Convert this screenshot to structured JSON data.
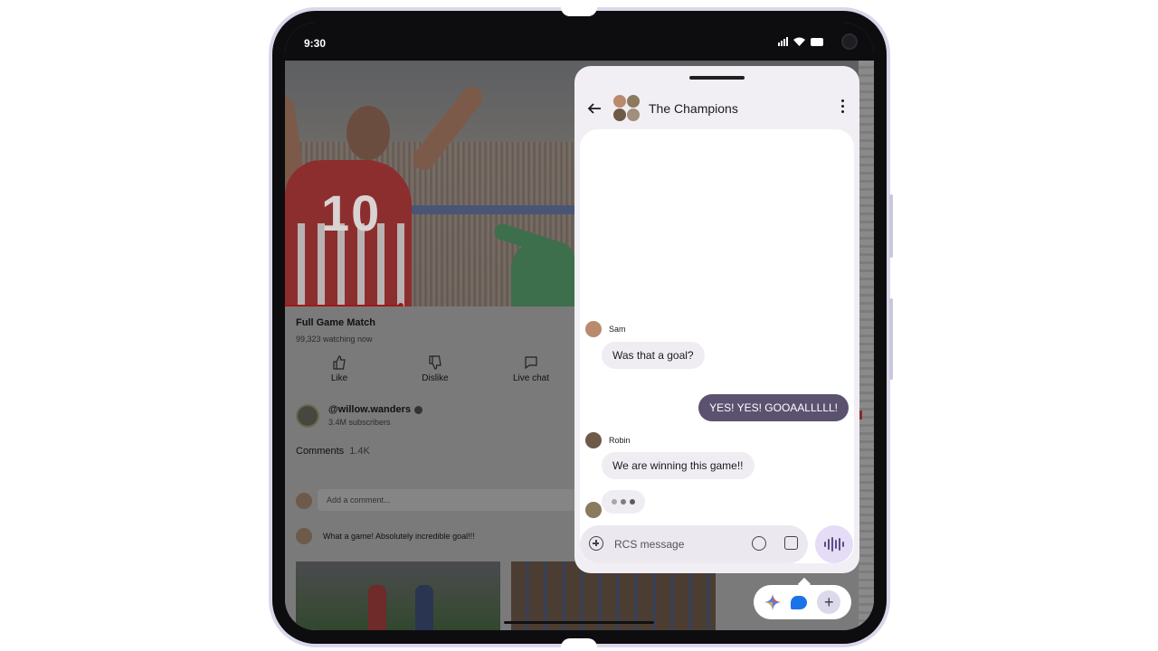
{
  "status_bar": {
    "time": "9:30"
  },
  "video": {
    "jersey_number": "10"
  },
  "youtube": {
    "title": "Full Game Match",
    "watching": "99,323 watching now",
    "actions": [
      {
        "label": "Like",
        "icon": "thumbs-up-icon"
      },
      {
        "label": "Dislike",
        "icon": "thumbs-down-icon"
      },
      {
        "label": "Live chat",
        "icon": "chat-icon"
      }
    ],
    "channel": {
      "name": "@willow.wanders",
      "subscribers": "3.4M subscribers"
    },
    "comments": {
      "label": "Comments",
      "count": "1.4K",
      "add_placeholder": "Add a comment...",
      "top_comment": "What a game! Absolutely incredible goal!!!"
    }
  },
  "chat": {
    "title": "The Champions",
    "messages": [
      {
        "sender": "Sam",
        "text": "Was that a goal?",
        "direction": "incoming"
      },
      {
        "sender": "",
        "text": "YES! YES! GOOAALLLLL!",
        "direction": "outgoing"
      },
      {
        "sender": "Robin",
        "text": "We are winning this game!!",
        "direction": "incoming"
      }
    ],
    "compose_placeholder": "RCS message"
  },
  "colors": {
    "outgoing_bubble": "#5b5270",
    "incoming_bubble": "#efedf2",
    "voice_button": "#e5dcf5",
    "messages_bubble_icon": "#1a73e8"
  },
  "bubble_bar": {
    "icons": [
      "gemini-icon",
      "messages-bubble-icon",
      "add-icon"
    ],
    "add_label": "+"
  }
}
